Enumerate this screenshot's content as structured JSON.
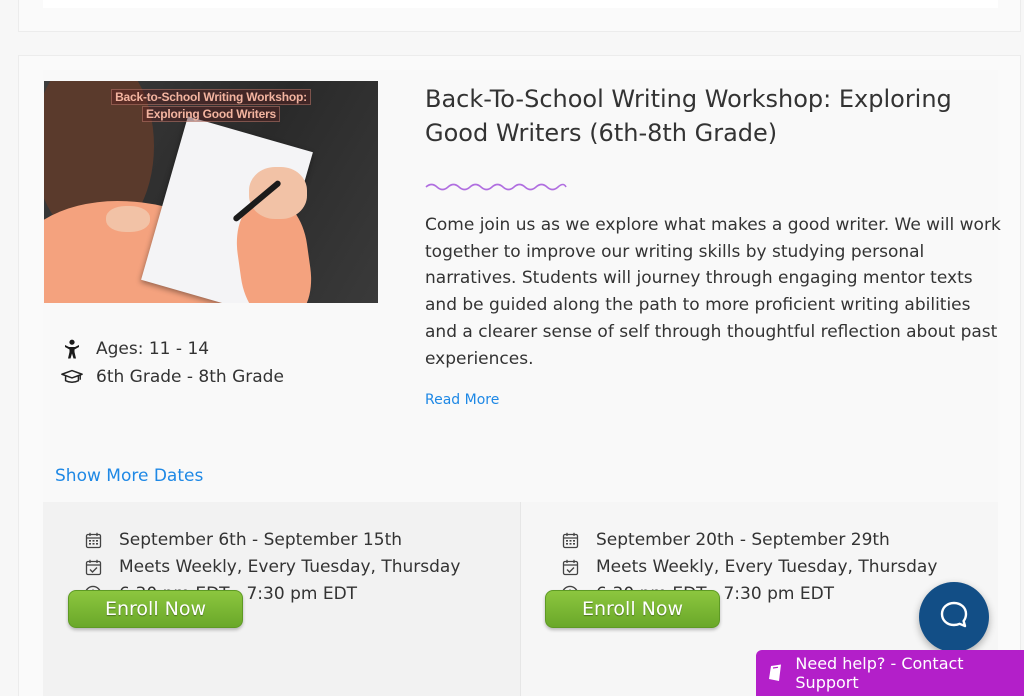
{
  "course": {
    "image_title_line1": "Back-to-School Writing Workshop:",
    "image_title_line2": "Exploring Good Writers",
    "title": "Back-To-School Writing Workshop: Exploring Good Writers (6th-8th Grade)",
    "description": "Come join us as we explore what makes a good writer. We will work together to improve our writing skills by studying personal narratives. Students will journey through engaging mentor texts and be guided along the path to more proficient writing abilities and a clearer sense of self through thoughtful reflection about past experiences.",
    "read_more": "Read More",
    "ages": "Ages: 11 - 14",
    "grades": "6th Grade - 8th Grade",
    "show_more_dates": "Show More Dates"
  },
  "sessions": [
    {
      "dates": "September 6th - September 15th",
      "meets": "Meets Weekly, Every Tuesday, Thursday",
      "time": "6:30 pm EDT - 7:30 pm EDT",
      "enroll_label": "Enroll Now"
    },
    {
      "dates": "September 20th - September 29th",
      "meets": "Meets Weekly, Every Tuesday, Thursday",
      "time": "6:30 pm EDT - 7:30 pm EDT",
      "enroll_label": "Enroll Now"
    }
  ],
  "support": {
    "label": "Need help? - Contact Support"
  },
  "icons": {
    "ages": "child-icon",
    "grades": "graduation-cap-icon",
    "dates": "calendar-icon",
    "meets": "calendar-check-icon",
    "time": "clock-icon",
    "chat": "chat-icon",
    "support": "support-icon"
  },
  "colors": {
    "link": "#1e88e5",
    "enroll": "#7ab733",
    "squiggle": "#b06ee0",
    "chat": "#124e86",
    "support": "#b31fc9"
  }
}
